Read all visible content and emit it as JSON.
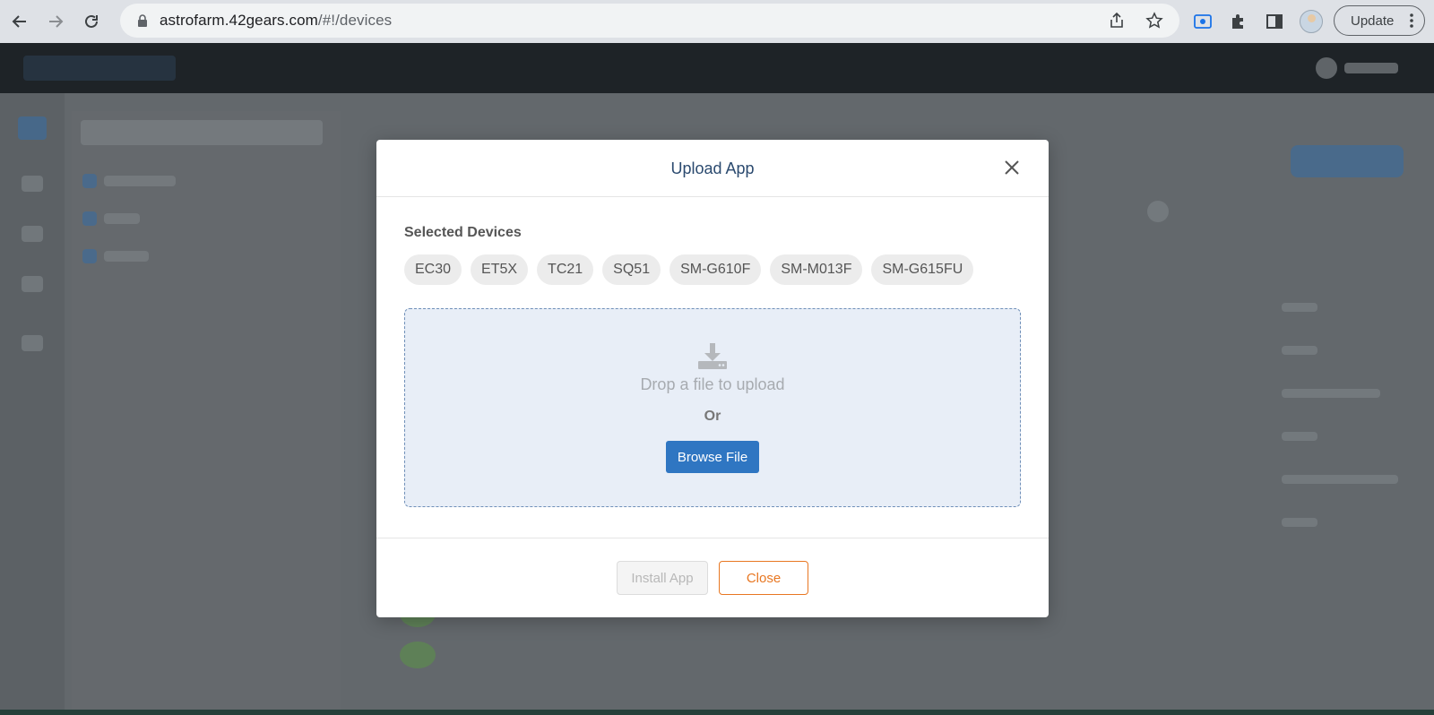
{
  "browser": {
    "url_host": "astrofarm.42gears.com",
    "url_path": "/#!/devices",
    "update_label": "Update"
  },
  "modal": {
    "title": "Upload App",
    "selected_devices_label": "Selected Devices",
    "devices": [
      "EC30",
      "ET5X",
      "TC21",
      "SQ51",
      "SM-G610F",
      "SM-M013F",
      "SM-G615FU"
    ],
    "dropzone": {
      "text": "Drop a file to upload",
      "or": "Or",
      "browse_label": "Browse File"
    },
    "footer": {
      "install_label": "Install App",
      "install_enabled": false,
      "close_label": "Close"
    }
  },
  "colors": {
    "accent": "#2f76c2",
    "close_orange": "#e87722",
    "title": "#2b4a6f"
  }
}
